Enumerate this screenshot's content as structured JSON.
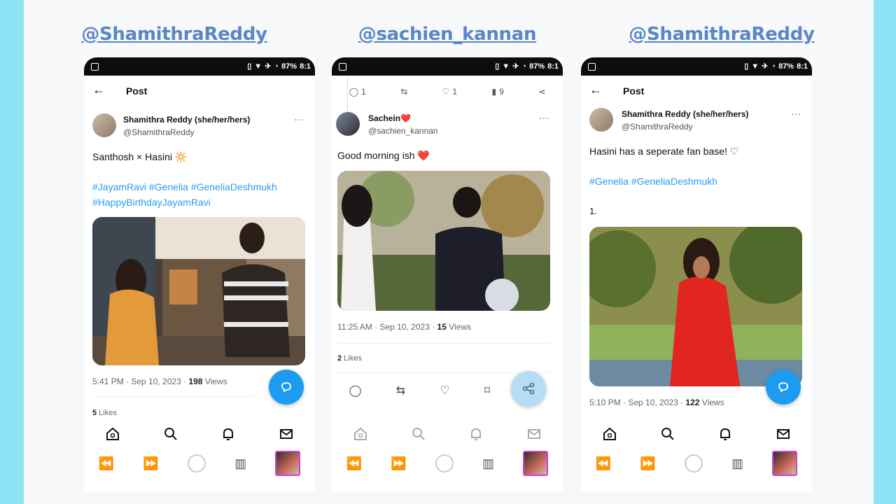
{
  "phones": [
    {
      "handle": "@ShamithraReddy",
      "status": {
        "battery": "87%",
        "time": "8:1"
      },
      "header_title": "Post",
      "author": {
        "name": "Shamithra Reddy (she/her/hers)",
        "username": "@ShamithraReddy"
      },
      "text": "Santhosh × Hasini 🔆",
      "hashtags": [
        "#JayamRavi #Genelia #GeneliaDeshmukh",
        "#HappyBirthdayJayamRavi"
      ],
      "timestamp": "5:41 PM · Sep 10, 2023 · ",
      "views_count": "198",
      "views_label": " Views",
      "likes_count": "5",
      "likes_label": " Likes"
    },
    {
      "handle": "@sachien_kannan",
      "status": {
        "battery": "87%",
        "time": "8:1"
      },
      "prev_stats": {
        "replies": "1",
        "likes": "1",
        "views": "9"
      },
      "author": {
        "name": "Sachein❤️",
        "username": "@sachien_kannan"
      },
      "text": "Good morning ish ❤️",
      "timestamp": "11:25 AM · Sep 10, 2023 · ",
      "views_count": "15",
      "views_label": " Views",
      "likes_count": "2",
      "likes_label": " Likes"
    },
    {
      "handle": "@ShamithraReddy",
      "status": {
        "battery": "87%",
        "time": "8:1"
      },
      "header_title": "Post",
      "author": {
        "name": "Shamithra Reddy (she/her/hers)",
        "username": "@ShamithraReddy"
      },
      "text": "Hasini has a seperate fan base! ♡",
      "hashtags": [
        "#Genelia #GeneliaDeshmukh"
      ],
      "list_number": "1.",
      "timestamp": "5:10 PM · Sep 10, 2023 · ",
      "views_count": "122",
      "views_label": " Views"
    }
  ],
  "colors": {
    "accent": "#1d9bf0",
    "handle": "#5b86c6",
    "hashtag": "#2a9bf0",
    "frame": "#8ee3f5"
  },
  "icons": {
    "nav": [
      "home-icon",
      "search-icon",
      "bell-icon",
      "mail-icon"
    ],
    "sys": [
      "rewind-icon",
      "forward-icon",
      "circle-icon",
      "book-icon",
      "thumbnail"
    ]
  }
}
